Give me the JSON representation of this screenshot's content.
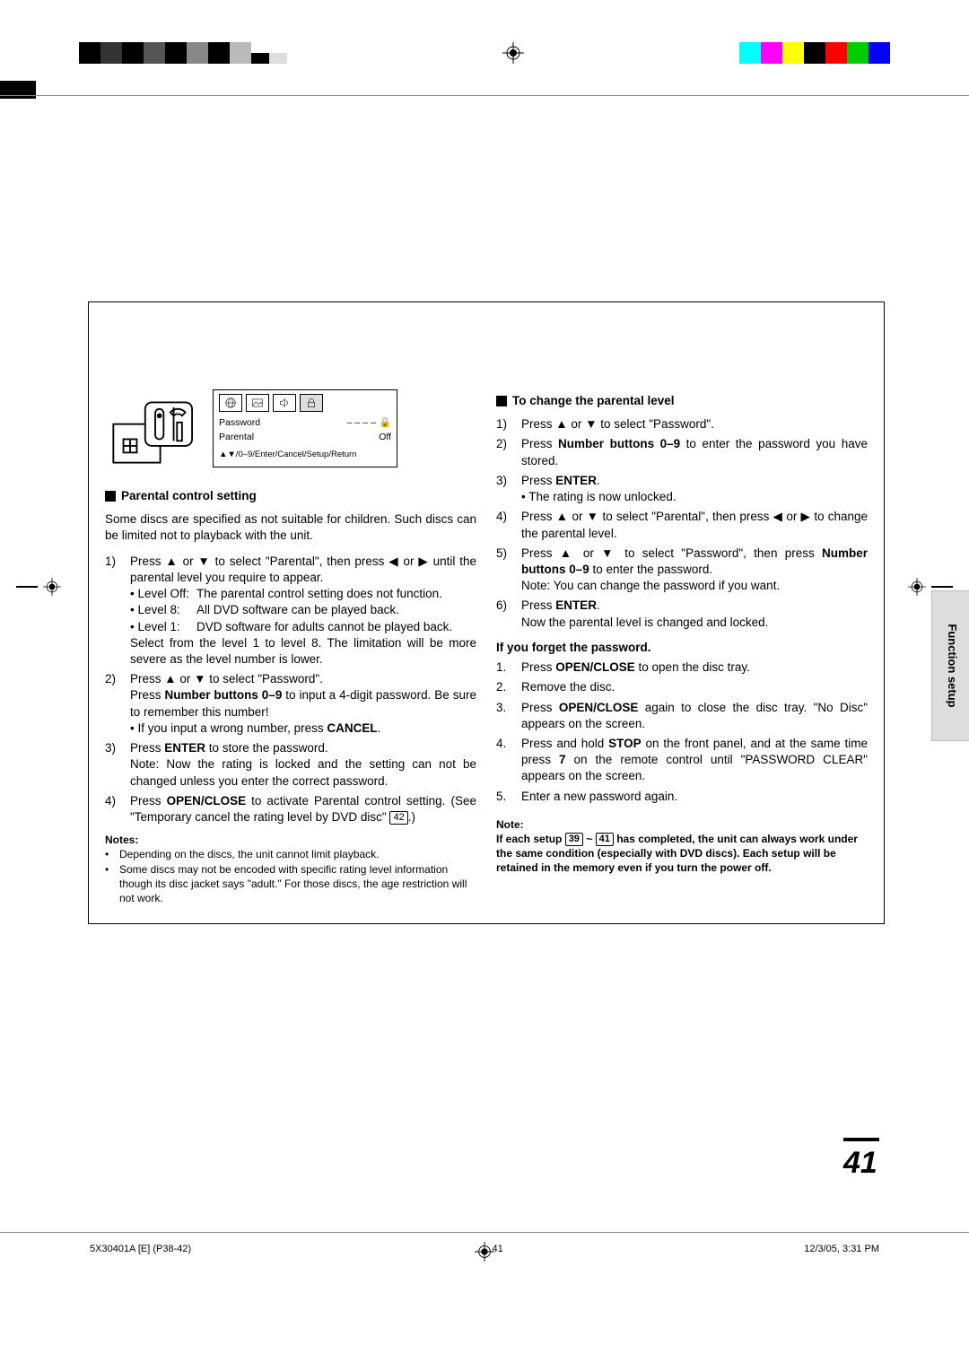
{
  "menubox": {
    "row1_label": "Password",
    "row1_value": "– – – –",
    "row2_label": "Parental",
    "row2_value": "Off",
    "footer": "▲▼/0–9/Enter/Cancel/Setup/Return"
  },
  "left": {
    "heading": "Parental control setting",
    "intro": "Some discs are specified as not suitable for children. Such discs can be limited not to playback with the unit.",
    "step1a": "Press ▲ or ▼ to select \"Parental\", then press ◀ or ▶ until the parental level you require to appear.",
    "leveloff_l": "• Level Off:",
    "leveloff_r": "The parental control setting does not function.",
    "level8_l": "• Level 8:",
    "level8_r": "All DVD software can be played back.",
    "level1_l": "• Level 1:",
    "level1_r": "DVD software for adults cannot be played back.",
    "step1b": "Select from the level 1 to level 8. The limitation will be more severe as the level number is lower.",
    "step2a": "Press ▲ or ▼ to select \"Password\".",
    "step2b_pre": "Press ",
    "step2b_bold": "Number buttons 0–9",
    "step2b_post": " to input a 4-digit password. Be sure to remember this number!",
    "step2c_pre": "• If you input a wrong number, press ",
    "step2c_bold": "CANCEL",
    "step2c_post": ".",
    "step3a_pre": "Press ",
    "step3a_bold": "ENTER",
    "step3a_post": " to store the password.",
    "step3b": "Note: Now the rating is locked and the setting can not be changed unless you enter the correct password.",
    "step4a_pre": "Press ",
    "step4a_bold": "OPEN/CLOSE",
    "step4a_post": " to activate Parental control setting. (See \"Temporary cancel the rating level by DVD disc\" ",
    "step4a_box": "42",
    "step4a_end": ".)",
    "notes_h": "Notes:",
    "note1": "Depending on the discs, the unit cannot limit playback.",
    "note2": "Some discs may not be encoded with specific rating level information though its disc jacket says \"adult.\" For those discs, the age restriction will not work."
  },
  "right": {
    "heading1": "To change the parental level",
    "c1": "Press ▲ or ▼ to select \"Password\".",
    "c2_pre": "Press ",
    "c2_bold": "Number buttons 0–9",
    "c2_post": " to enter the password you have stored.",
    "c3_pre": "Press ",
    "c3_bold": "ENTER",
    "c3_post": ".",
    "c3b": "• The rating is now unlocked.",
    "c4": "Press ▲ or ▼ to select \"Parental\", then press ◀ or ▶ to change the parental level.",
    "c5a": "Press ▲ or ▼ to select \"Password\", then press ",
    "c5b_bold": "Number buttons 0–9",
    "c5b_post": " to enter the password.",
    "c5c": "Note: You can change the password if you want.",
    "c6_pre": "Press ",
    "c6_bold": "ENTER",
    "c6_post": ".",
    "c6b": "Now the parental level is changed and locked.",
    "heading2": "If you forget the password.",
    "f1_pre": "Press ",
    "f1_bold": "OPEN/CLOSE",
    "f1_post": " to open the disc tray.",
    "f2": "Remove the disc.",
    "f3_pre": "Press ",
    "f3_bold": "OPEN/CLOSE",
    "f3_post": " again to close the disc tray. \"No Disc\" appears on the screen.",
    "f4_pre": "Press and hold ",
    "f4_bold1": "STOP",
    "f4_mid": " on the front panel, and at the same time press ",
    "f4_bold2": "7",
    "f4_post": " on the remote control until \"PASSWORD CLEAR\" appears on the screen.",
    "f5": "Enter a new password again.",
    "note_h": "Note:",
    "note_body_pre": "If each setup ",
    "note_box1": "39",
    "note_tilde": " ~ ",
    "note_box2": "41",
    "note_body_post": " has completed, the unit can always work under the same condition (especially with DVD discs). Each setup will be retained in the memory even if you turn the power off."
  },
  "sidetab": "Function setup",
  "pagenum": "41",
  "footer": {
    "left": "5X30401A [E] (P38-42)",
    "center": "41",
    "right": "12/3/05, 3:31 PM"
  }
}
